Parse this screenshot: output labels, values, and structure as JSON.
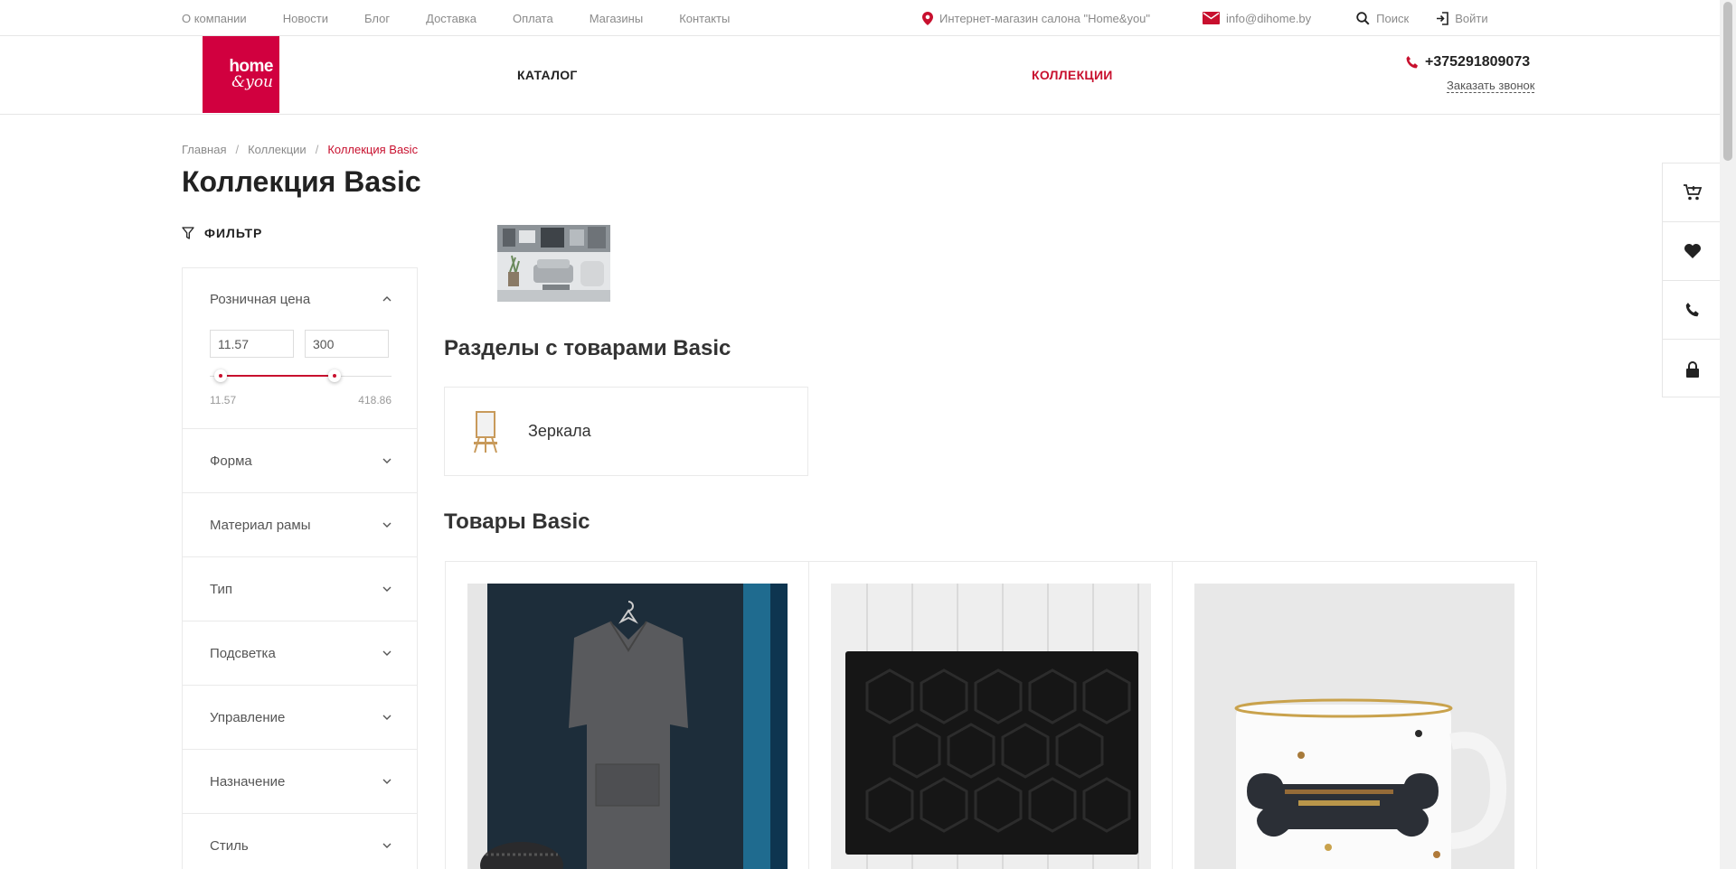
{
  "top_nav": [
    "О компании",
    "Новости",
    "Блог",
    "Доставка",
    "Оплата",
    "Магазины",
    "Контакты"
  ],
  "top_info": {
    "store": "Интернет-магазин салона \"Home&you\"",
    "email": "info@dihome.by",
    "search": "Поиск",
    "login": "Войти"
  },
  "logo": {
    "line1": "home",
    "line2": "&you"
  },
  "main_nav": {
    "catalog": "КАТАЛОГ",
    "collections": "КОЛЛЕКЦИИ"
  },
  "contact": {
    "phone": "+375291809073",
    "callback": "Заказать звонок"
  },
  "breadcrumb": [
    "Главная",
    "Коллекции",
    "Коллекция Basic"
  ],
  "page_title": "Коллекция Basic",
  "filter": {
    "title": "ФИЛЬТР",
    "price": {
      "label": "Розничная цена",
      "from": "11.57",
      "to": "300",
      "min": "11.57",
      "max": "418.86"
    },
    "sections": [
      "Форма",
      "Материал рамы",
      "Тип",
      "Подсветка",
      "Управление",
      "Назначение",
      "Стиль"
    ]
  },
  "sections_title": "Разделы с товарами Basic",
  "section_card": {
    "name": "Зеркала"
  },
  "products_title": "Товары Basic",
  "colors": {
    "accent": "#c8102e",
    "logo_bg": "#d1003f"
  },
  "side_panel_icons": [
    "cart-icon",
    "heart-icon",
    "phone-icon",
    "lock-icon"
  ]
}
